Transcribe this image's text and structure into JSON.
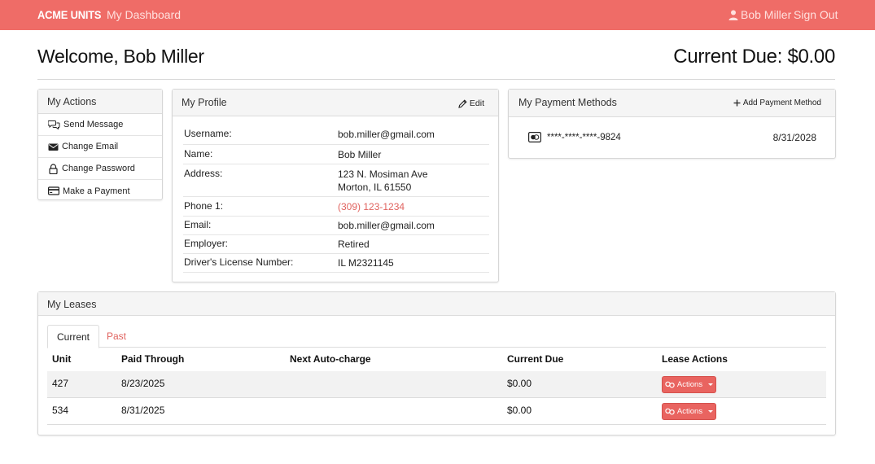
{
  "nav": {
    "brand": "ACME UNITS",
    "dashboard": "My Dashboard",
    "user": "Bob Miller",
    "signout": "Sign Out"
  },
  "header": {
    "welcome": "Welcome, Bob Miller",
    "current_due": "Current Due: $0.00"
  },
  "actions": {
    "title": "My Actions",
    "items": [
      {
        "label": "Send Message",
        "icon": "chat-icon"
      },
      {
        "label": "Change Email",
        "icon": "envelope-icon"
      },
      {
        "label": "Change Password",
        "icon": "lock-icon"
      },
      {
        "label": "Make a Payment",
        "icon": "credit-card-icon"
      }
    ]
  },
  "profile": {
    "title": "My Profile",
    "edit_label": "Edit",
    "fields": [
      {
        "label": "Username:",
        "value": "bob.miller@gmail.com"
      },
      {
        "label": "Name:",
        "value": "Bob Miller"
      },
      {
        "label": "Address:",
        "value": "123 N. Mosiman Ave",
        "value2": "Morton, IL 61550"
      },
      {
        "label": "Phone 1:",
        "value": "(309) 123-1234"
      },
      {
        "label": "Email:",
        "value": "bob.miller@gmail.com"
      },
      {
        "label": "Employer:",
        "value": "Retired"
      },
      {
        "label": "Driver's License Number:",
        "value": "IL M2321145"
      }
    ]
  },
  "payment": {
    "title": "My Payment Methods",
    "add_label": "Add Payment Method",
    "cards": [
      {
        "number": "****-****-****-9824",
        "expiry": "8/31/2028"
      }
    ]
  },
  "leases": {
    "title": "My Leases",
    "tabs": [
      "Current",
      "Past"
    ],
    "active_tab": "Current",
    "columns": [
      "Unit",
      "Paid Through",
      "Next Auto-charge",
      "Current Due",
      "Lease Actions"
    ],
    "rows": [
      {
        "unit": "427",
        "paid_through": "8/23/2025",
        "next_auto": "",
        "current_due": "$0.00",
        "action": "Actions"
      },
      {
        "unit": "534",
        "paid_through": "8/31/2025",
        "next_auto": "",
        "current_due": "$0.00",
        "action": "Actions"
      }
    ]
  },
  "colors": {
    "brand": "#ef6c67",
    "link": "#e0625e",
    "button": "#e96460"
  }
}
